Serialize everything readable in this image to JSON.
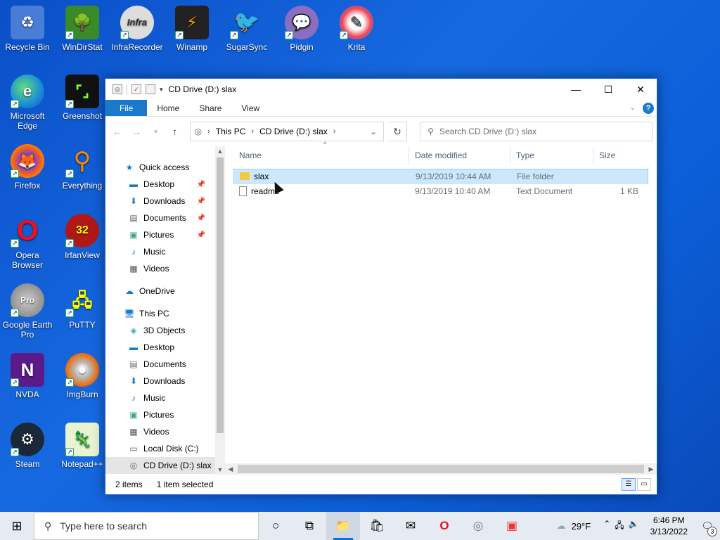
{
  "desktop": {
    "icons": [
      {
        "label": "Recycle Bin",
        "icon": "recycle-bin-icon"
      },
      {
        "label": "WinDirStat",
        "icon": "windirstat-icon"
      },
      {
        "label": "InfraRecorder",
        "icon": "infrarecorder-icon"
      },
      {
        "label": "Winamp",
        "icon": "winamp-icon"
      },
      {
        "label": "SugarSync",
        "icon": "sugarsync-icon"
      },
      {
        "label": "Pidgin",
        "icon": "pidgin-icon"
      },
      {
        "label": "Krita",
        "icon": "krita-icon"
      },
      {
        "label": "Microsoft Edge",
        "icon": "edge-icon"
      },
      {
        "label": "Greenshot",
        "icon": "greenshot-icon"
      },
      {
        "label": "Firefox",
        "icon": "firefox-icon"
      },
      {
        "label": "Everything",
        "icon": "everything-icon"
      },
      {
        "label": "Opera Browser",
        "icon": "opera-icon"
      },
      {
        "label": "IrfanView",
        "icon": "irfanview-icon"
      },
      {
        "label": "Google Earth Pro",
        "icon": "google-earth-icon"
      },
      {
        "label": "PuTTY",
        "icon": "putty-icon"
      },
      {
        "label": "NVDA",
        "icon": "nvda-icon"
      },
      {
        "label": "ImgBurn",
        "icon": "imgburn-icon"
      },
      {
        "label": "Steam",
        "icon": "steam-icon"
      },
      {
        "label": "Notepad++",
        "icon": "notepadpp-icon"
      }
    ],
    "badges": {
      "irfanview": "32",
      "infrarecorder": "Infra"
    }
  },
  "window": {
    "title": "CD Drive (D:) slax",
    "ribbon_tabs": [
      "File",
      "Home",
      "Share",
      "View"
    ],
    "help": "?",
    "address": {
      "crumbs": [
        "This PC",
        "CD Drive (D:) slax"
      ]
    },
    "search_placeholder": "Search CD Drive (D:) slax",
    "nav": {
      "quick_access": "Quick access",
      "quick_items": [
        "Desktop",
        "Downloads",
        "Documents",
        "Pictures",
        "Music",
        "Videos"
      ],
      "onedrive": "OneDrive",
      "this_pc": "This PC",
      "pc_items": [
        "3D Objects",
        "Desktop",
        "Documents",
        "Downloads",
        "Music",
        "Pictures",
        "Videos",
        "Local Disk (C:)",
        "CD Drive (D:) slax"
      ]
    },
    "columns": {
      "name": "Name",
      "date": "Date modified",
      "type": "Type",
      "size": "Size"
    },
    "files": [
      {
        "name": "slax",
        "date": "9/13/2019 10:44 AM",
        "type": "File folder",
        "size": ""
      },
      {
        "name": "readme",
        "date": "9/13/2019 10:40 AM",
        "type": "Text Document",
        "size": "1 KB"
      }
    ],
    "status": {
      "count": "2 items",
      "selected": "1 item selected"
    }
  },
  "taskbar": {
    "search_placeholder": "Type here to search",
    "temperature": "29°F",
    "time": "6:46 PM",
    "date": "3/13/2022",
    "notifications": "3"
  },
  "colors": {
    "accent": "#1979ca",
    "selection": "#cce8ff",
    "desktop": "#0b5ed7"
  }
}
